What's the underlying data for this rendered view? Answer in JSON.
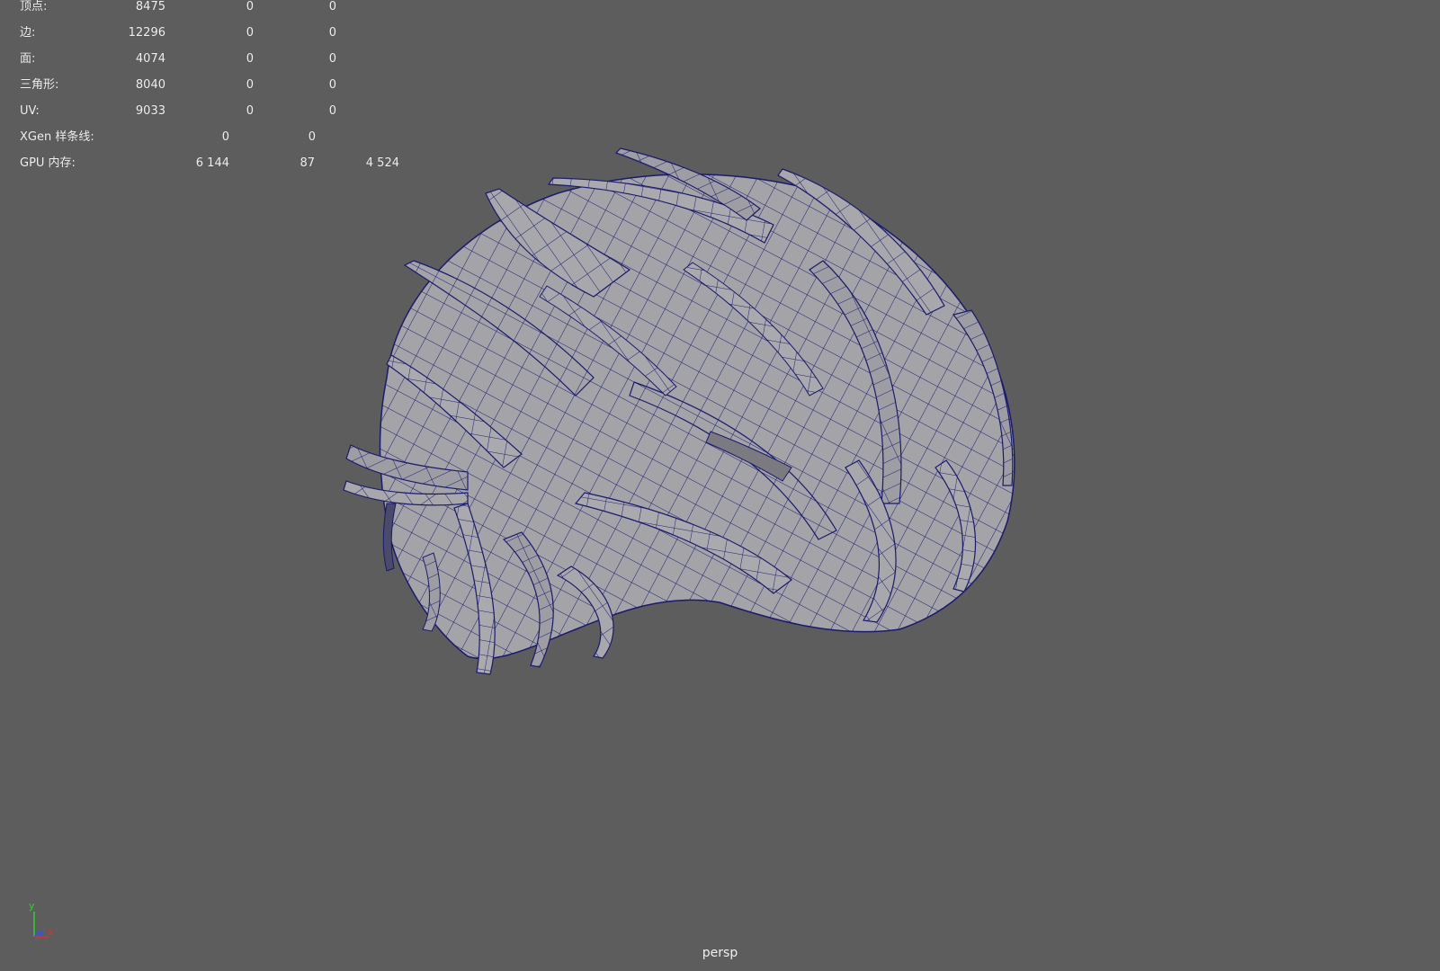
{
  "hud": {
    "vertices": {
      "label": "顶点:",
      "v1": "8475",
      "v2": "0",
      "v3": "0"
    },
    "edges": {
      "label": "边:",
      "v1": "12296",
      "v2": "0",
      "v3": "0"
    },
    "faces": {
      "label": "面:",
      "v1": "4074",
      "v2": "0",
      "v3": "0"
    },
    "tris": {
      "label": "三角形:",
      "v1": "8040",
      "v2": "0",
      "v3": "0"
    },
    "uvs": {
      "label": "UV:",
      "v1": "9033",
      "v2": "0",
      "v3": "0"
    },
    "xgen": {
      "label": "XGen 样条线:",
      "v1": "0",
      "v2": "0"
    },
    "gpu": {
      "label": "GPU 内存:",
      "v1": "6 144",
      "v2": "87",
      "v3": "4 524"
    }
  },
  "viewport": {
    "camera": "persp",
    "background": "#5d5d5d",
    "mesh_fill": "#a3a3a8",
    "wire_color": "#1a1a6e"
  },
  "gizmo": {
    "x_label": "x",
    "y_label": "y",
    "z_label": "z",
    "x_color": "#e03030",
    "y_color": "#30d030",
    "z_color": "#3050ff"
  }
}
